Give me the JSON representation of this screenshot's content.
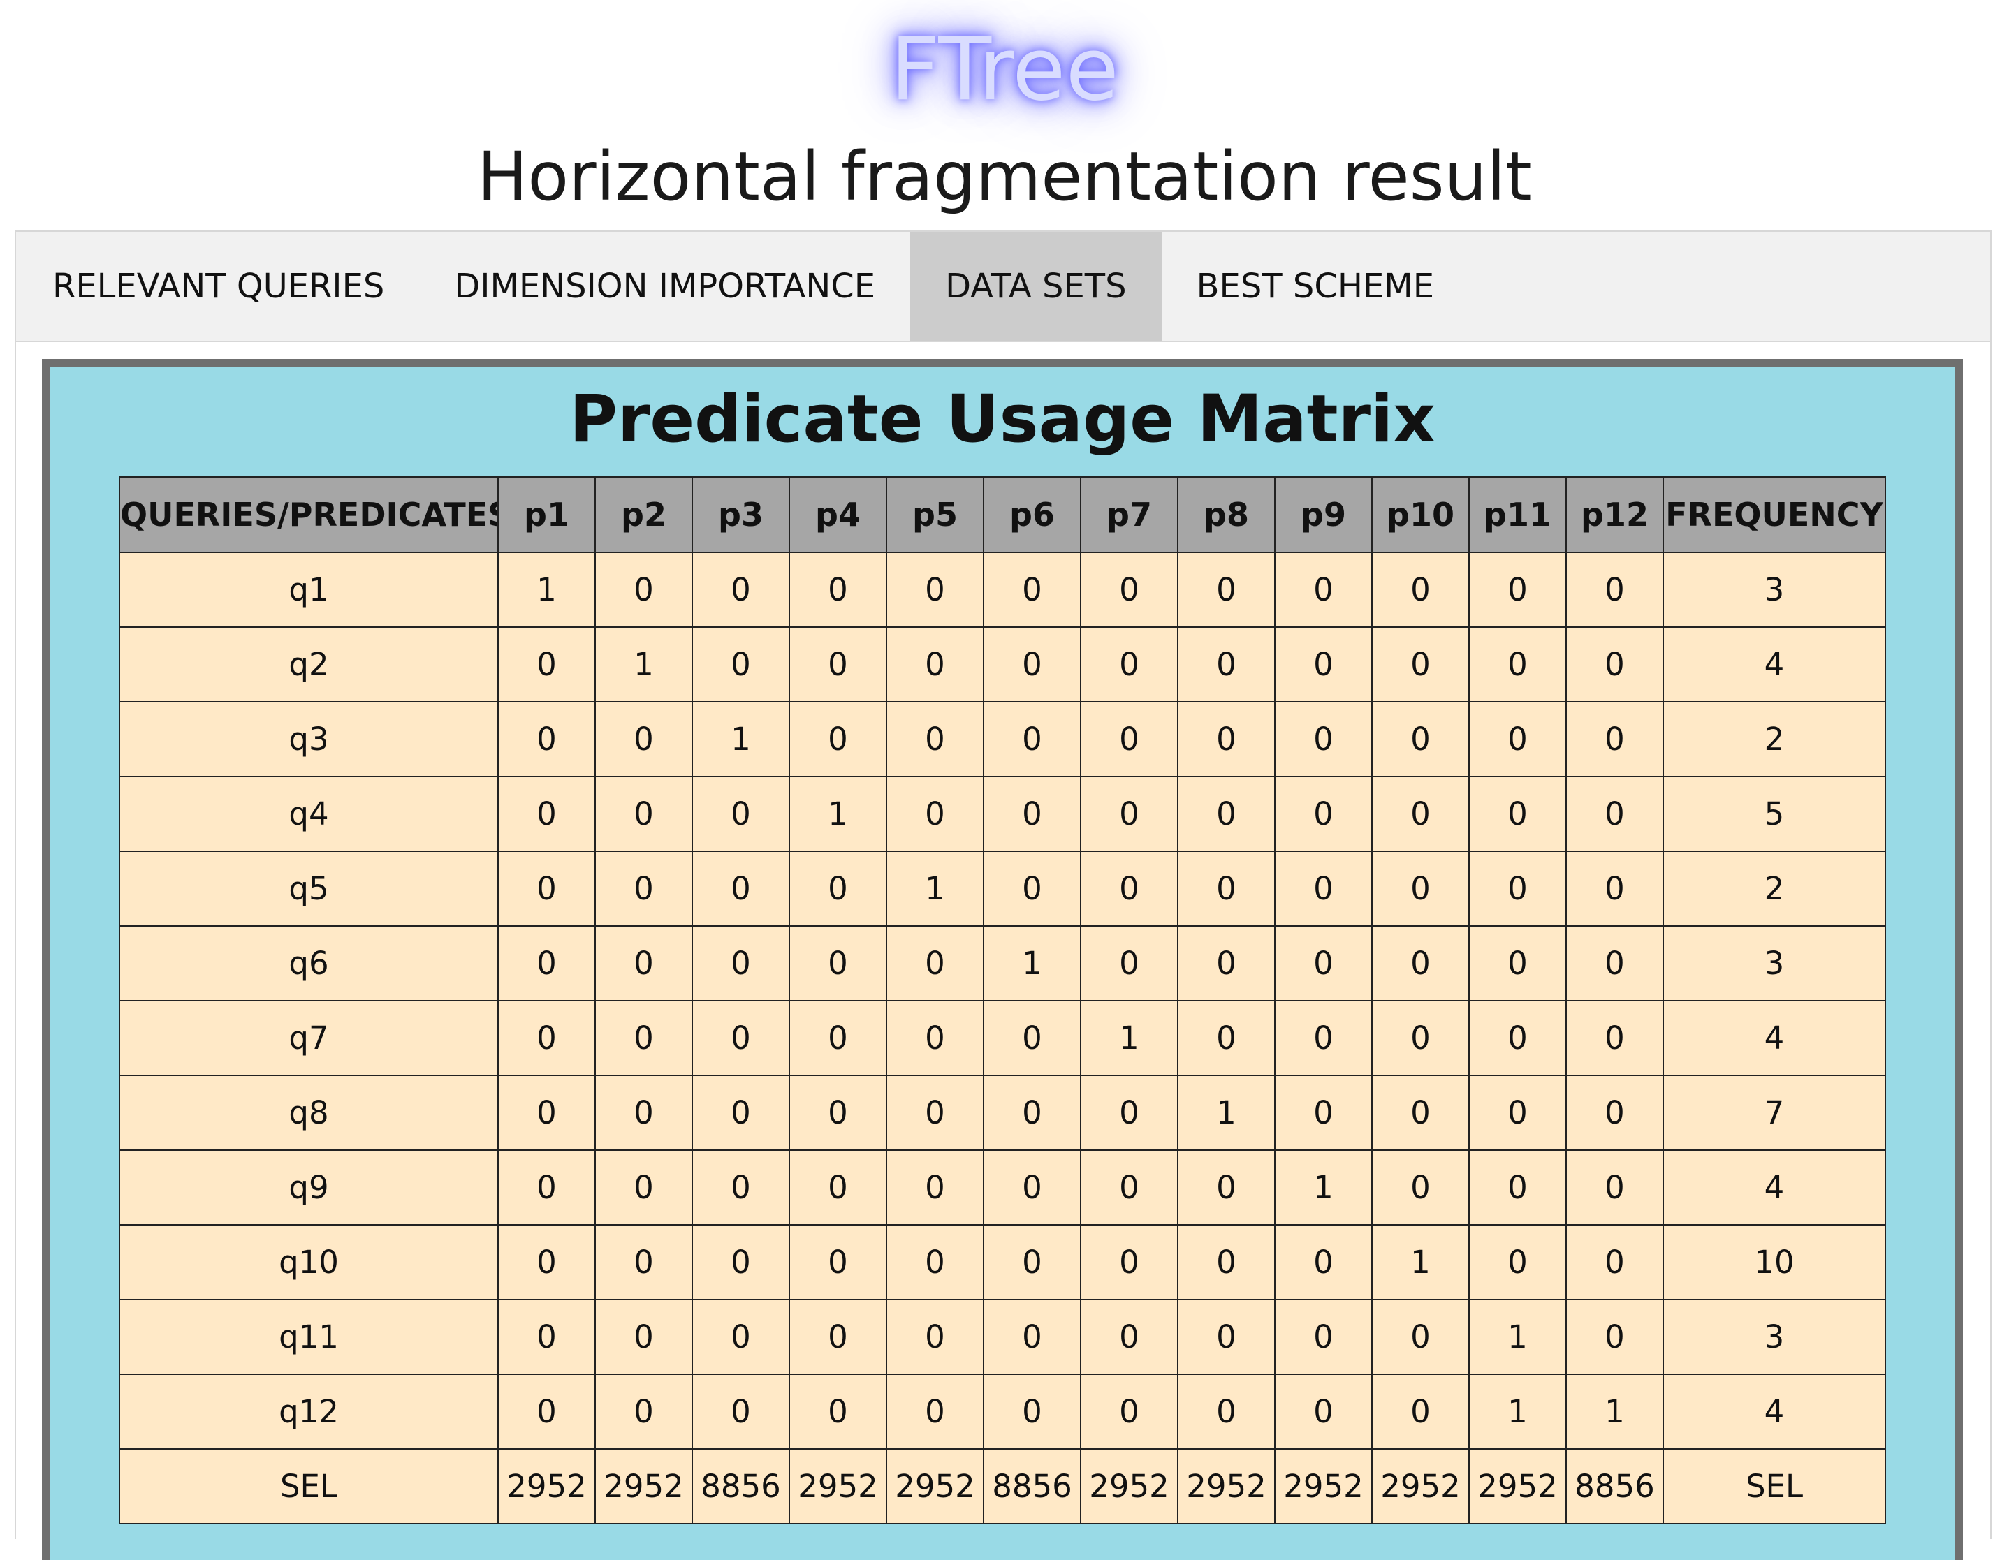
{
  "app": {
    "logo": "FTree",
    "subtitle": "Horizontal fragmentation result"
  },
  "tabs": [
    {
      "label": "RELEVANT QUERIES",
      "active": false
    },
    {
      "label": "DIMENSION IMPORTANCE",
      "active": false
    },
    {
      "label": "DATA SETS",
      "active": true
    },
    {
      "label": "BEST SCHEME",
      "active": false
    }
  ],
  "panel": {
    "title": "Predicate Usage Matrix",
    "headers": [
      "QUERIES/PREDICATES",
      "p1",
      "p2",
      "p3",
      "p4",
      "p5",
      "p6",
      "p7",
      "p8",
      "p9",
      "p10",
      "p11",
      "p12",
      "FREQUENCY"
    ],
    "rows": [
      [
        "q1",
        "1",
        "0",
        "0",
        "0",
        "0",
        "0",
        "0",
        "0",
        "0",
        "0",
        "0",
        "0",
        "3"
      ],
      [
        "q2",
        "0",
        "1",
        "0",
        "0",
        "0",
        "0",
        "0",
        "0",
        "0",
        "0",
        "0",
        "0",
        "4"
      ],
      [
        "q3",
        "0",
        "0",
        "1",
        "0",
        "0",
        "0",
        "0",
        "0",
        "0",
        "0",
        "0",
        "0",
        "2"
      ],
      [
        "q4",
        "0",
        "0",
        "0",
        "1",
        "0",
        "0",
        "0",
        "0",
        "0",
        "0",
        "0",
        "0",
        "5"
      ],
      [
        "q5",
        "0",
        "0",
        "0",
        "0",
        "1",
        "0",
        "0",
        "0",
        "0",
        "0",
        "0",
        "0",
        "2"
      ],
      [
        "q6",
        "0",
        "0",
        "0",
        "0",
        "0",
        "1",
        "0",
        "0",
        "0",
        "0",
        "0",
        "0",
        "3"
      ],
      [
        "q7",
        "0",
        "0",
        "0",
        "0",
        "0",
        "0",
        "1",
        "0",
        "0",
        "0",
        "0",
        "0",
        "4"
      ],
      [
        "q8",
        "0",
        "0",
        "0",
        "0",
        "0",
        "0",
        "0",
        "1",
        "0",
        "0",
        "0",
        "0",
        "7"
      ],
      [
        "q9",
        "0",
        "0",
        "0",
        "0",
        "0",
        "0",
        "0",
        "0",
        "1",
        "0",
        "0",
        "0",
        "4"
      ],
      [
        "q10",
        "0",
        "0",
        "0",
        "0",
        "0",
        "0",
        "0",
        "0",
        "0",
        "1",
        "0",
        "0",
        "10"
      ],
      [
        "q11",
        "0",
        "0",
        "0",
        "0",
        "0",
        "0",
        "0",
        "0",
        "0",
        "0",
        "1",
        "0",
        "3"
      ],
      [
        "q12",
        "0",
        "0",
        "0",
        "0",
        "0",
        "0",
        "0",
        "0",
        "0",
        "0",
        "1",
        "1",
        "4"
      ],
      [
        "SEL",
        "2952",
        "2952",
        "8856",
        "2952",
        "2952",
        "8856",
        "2952",
        "2952",
        "2952",
        "2952",
        "2952",
        "8856",
        "SEL"
      ]
    ]
  },
  "colors": {
    "panel_bg": "#99dae6",
    "panel_border": "#6f6f6f",
    "header_bg": "#a6a6a6",
    "cell_bg": "#ffe9c7",
    "tab_active_bg": "#cccccc",
    "logo_glow": "#6d6cff"
  }
}
